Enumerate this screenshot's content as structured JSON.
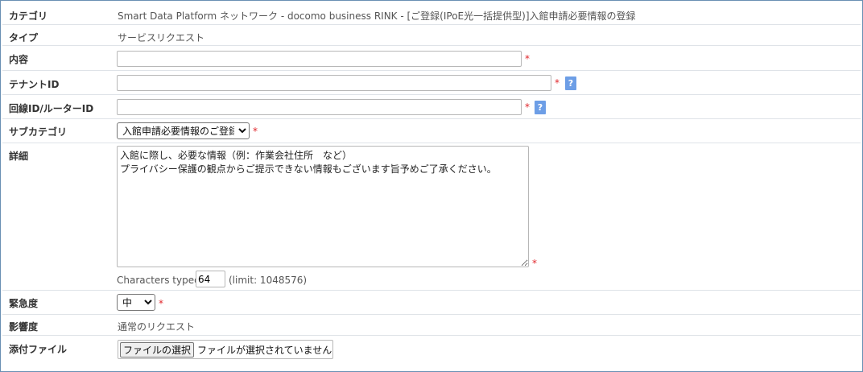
{
  "rows": {
    "category": {
      "label": "カテゴリ",
      "value": "Smart Data Platform ネットワーク - docomo business RINK - [ご登録(IPoE光一括提供型)]入館申請必要情報の登録"
    },
    "type": {
      "label": "タイプ",
      "value": "サービスリクエスト"
    },
    "content": {
      "label": "内容",
      "input_value": "",
      "required": "*"
    },
    "tenant": {
      "label": "テナントID",
      "input_value": "",
      "required": "*",
      "help": "?"
    },
    "line": {
      "label": "回線ID/ルーターID",
      "input_value": "",
      "required": "*",
      "help": "?"
    },
    "subcategory": {
      "label": "サブカテゴリ",
      "selected": "入館申請必要情報のご登録",
      "required": "*"
    },
    "detail": {
      "label": "詳細",
      "text": "入館に際し、必要な情報（例：作業会社住所　など）\nプライバシー保護の観点からご提示できない情報もございます旨予めご了承ください。",
      "required": "*",
      "chars_label": "Characters typed:",
      "chars_count": "64",
      "limit": "(limit: 1048576)"
    },
    "urgency": {
      "label": "緊急度",
      "selected": "中",
      "required": "*"
    },
    "impact": {
      "label": "影響度",
      "value": "通常のリクエスト"
    },
    "attachment": {
      "label": "添付ファイル",
      "button": "ファイルの選択",
      "status": "ファイルが選択されていません"
    }
  }
}
